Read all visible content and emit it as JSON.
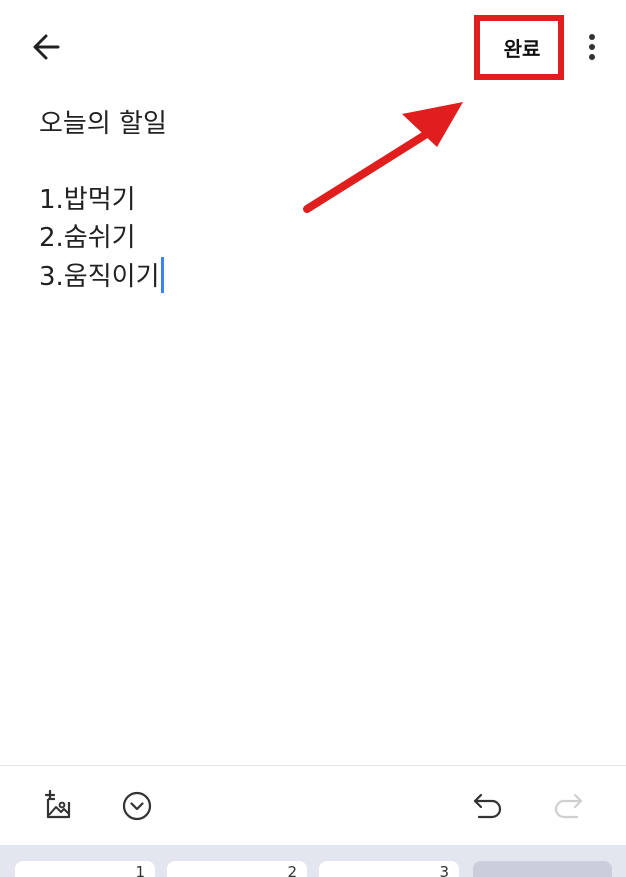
{
  "topbar": {
    "back_icon": "arrow-left-icon",
    "done_label": "완료",
    "more_icon": "vertical-dots-icon"
  },
  "note": {
    "lines": [
      "오늘의 할일",
      "",
      "1.밥먹기",
      "2.숨쉬기",
      "3.움직이기"
    ]
  },
  "toolbar": {
    "icons": [
      "add-image-icon",
      "expand-circle-icon",
      "undo-icon",
      "redo-icon"
    ],
    "redo_enabled": false
  },
  "keyboard": {
    "keys": [
      "1",
      "2",
      "3",
      ""
    ]
  },
  "colors": {
    "annotation_red": "#e01e1e",
    "caret_blue": "#3b82f6",
    "text": "#222222",
    "keyboard_bg": "#e3e6ee"
  }
}
